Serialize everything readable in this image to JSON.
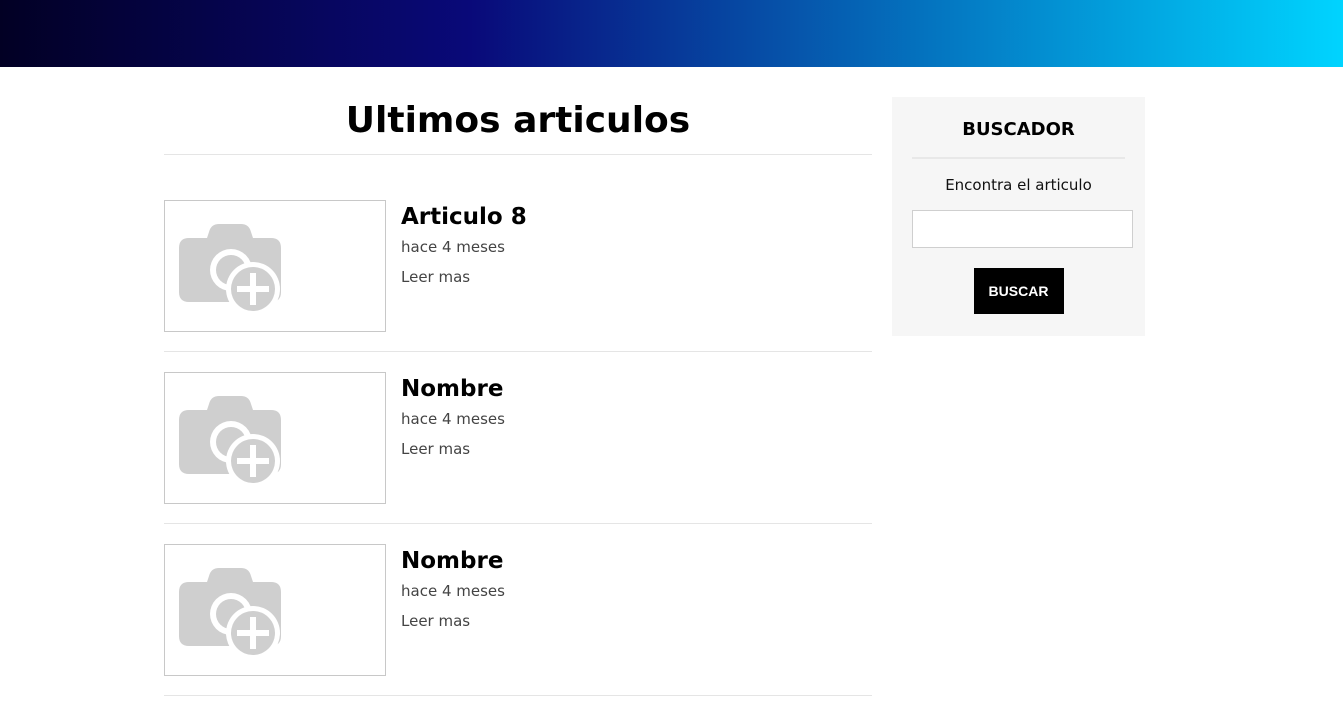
{
  "main": {
    "title": "Ultimos articulos",
    "articles": [
      {
        "title": "Articulo 8",
        "date": "hace 4 meses",
        "link_label": "Leer mas",
        "image_icon": "camera-plus-icon"
      },
      {
        "title": "Nombre",
        "date": "hace 4 meses",
        "link_label": "Leer mas",
        "image_icon": "camera-plus-icon"
      },
      {
        "title": "Nombre",
        "date": "hace 4 meses",
        "link_label": "Leer mas",
        "image_icon": "camera-plus-icon"
      }
    ]
  },
  "sidebar": {
    "title": "BUSCADOR",
    "label": "Encontra el articulo",
    "search_value": "",
    "button_label": "BUSCAR"
  },
  "colors": {
    "banner_start": "#020024",
    "banner_mid": "#090979",
    "banner_end": "#00d4ff",
    "sidebar_bg": "#f6f6f6",
    "button_bg": "#000000",
    "placeholder_icon": "#cfcfcf"
  }
}
